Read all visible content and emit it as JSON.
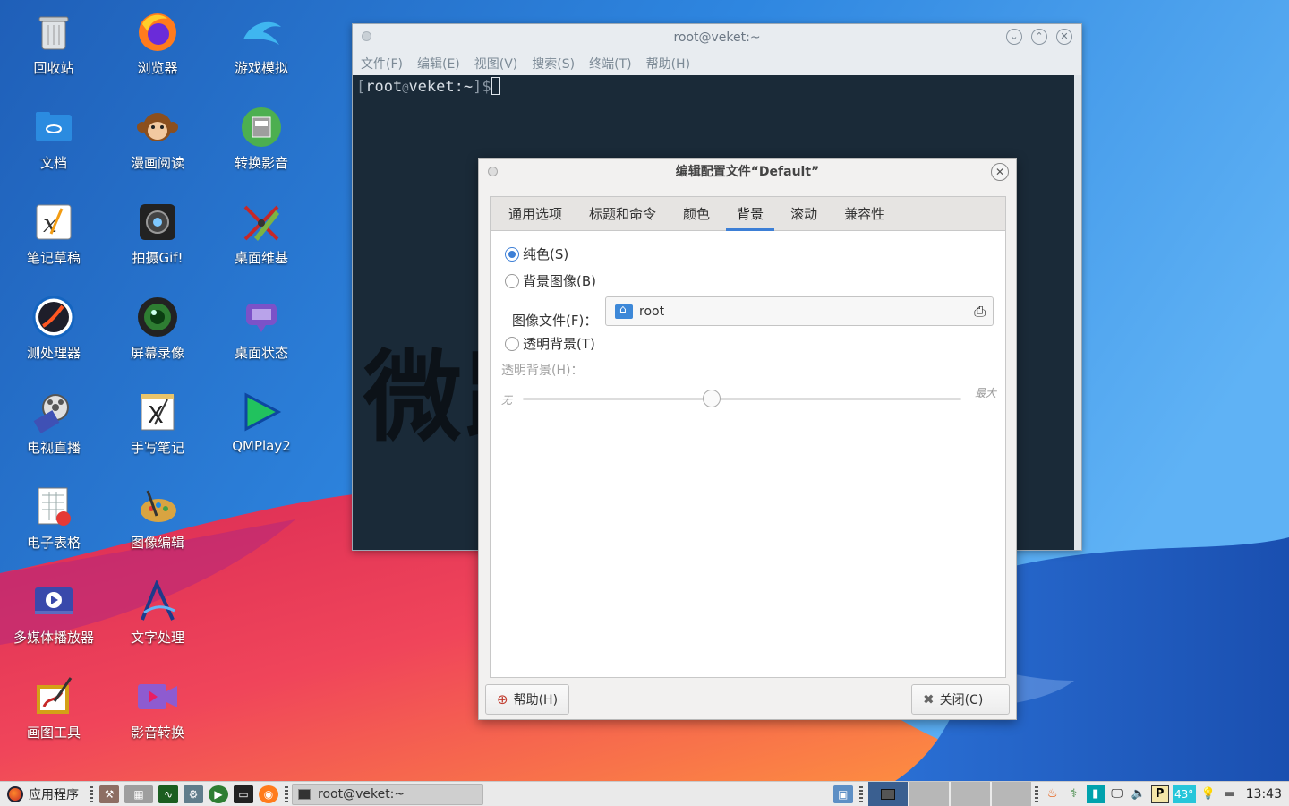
{
  "desktop": {
    "icons": [
      {
        "label": "回收站"
      },
      {
        "label": "浏览器"
      },
      {
        "label": "游戏模拟"
      },
      {
        "label": "文档"
      },
      {
        "label": "漫画阅读"
      },
      {
        "label": "转换影音"
      },
      {
        "label": "笔记草稿"
      },
      {
        "label": "拍摄Gif!"
      },
      {
        "label": "桌面维基"
      },
      {
        "label": "测处理器"
      },
      {
        "label": "屏幕录像"
      },
      {
        "label": "桌面状态"
      },
      {
        "label": "电视直播"
      },
      {
        "label": "手写笔记"
      },
      {
        "label": "QMPlay2"
      },
      {
        "label": "电子表格"
      },
      {
        "label": "图像编辑"
      },
      {
        "label": "多媒体播放器"
      },
      {
        "label": "文字处理"
      },
      {
        "label": "画图工具"
      },
      {
        "label": "影音转换"
      }
    ]
  },
  "terminal": {
    "title": "root@veket:~",
    "menu": [
      "文件(F)",
      "编辑(E)",
      "视图(V)",
      "搜索(S)",
      "终端(T)",
      "帮助(H)"
    ],
    "prompt_user": "root",
    "prompt_at": "@",
    "prompt_host": "veket",
    "prompt_path": ":~",
    "prompt_open": "[",
    "prompt_close": "]$",
    "background_text": "微跑"
  },
  "dialog": {
    "title": "编辑配置文件“Default”",
    "tabs": [
      "通用选项",
      "标题和命令",
      "颜色",
      "背景",
      "滚动",
      "兼容性"
    ],
    "active_tab": "背景",
    "radio_solid": "纯色(S)",
    "radio_image": "背景图像(B)",
    "image_file_label": "图像文件(F)：",
    "image_file_value": "root",
    "radio_transparent": "透明背景(T)",
    "transparency_label": "透明背景(H)：",
    "slider_min": "无",
    "slider_max": "最大",
    "slider_value": 0.43,
    "help_button": "帮助(H)",
    "close_button": "关闭(C)"
  },
  "taskbar": {
    "start_label": "应用程序",
    "task_title": "root@veket:~",
    "temperature": "43°",
    "clock": "13:43"
  }
}
